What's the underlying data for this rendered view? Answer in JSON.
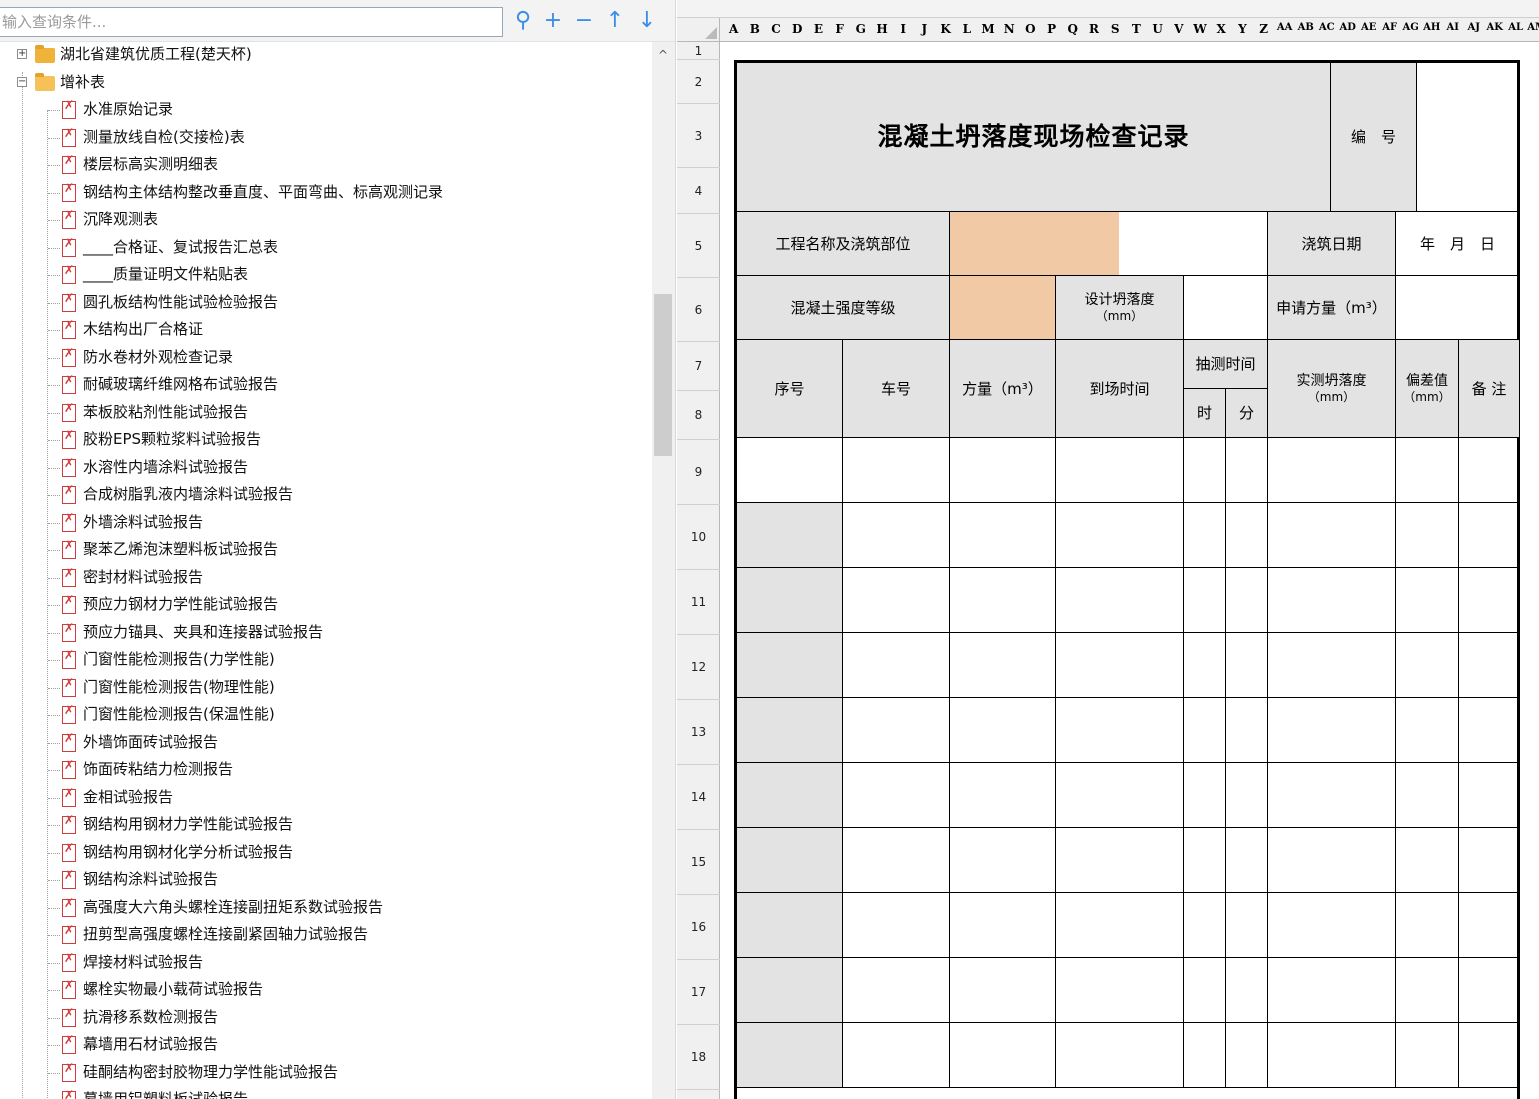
{
  "search": {
    "placeholder": "输入查询条件..."
  },
  "tree": {
    "nodes": [
      {
        "label": "湖北省建筑优质工程(楚天杯)",
        "type": "folder",
        "expanded": false
      },
      {
        "label": "增补表",
        "type": "folder",
        "expanded": true
      },
      {
        "label": "水准原始记录"
      },
      {
        "label": "测量放线自检(交接检)表"
      },
      {
        "label": "楼层标高实测明细表"
      },
      {
        "label": "钢结构主体结构整改垂直度、平面弯曲、标高观测记录"
      },
      {
        "label": "沉降观测表"
      },
      {
        "label": "____合格证、复试报告汇总表"
      },
      {
        "label": "____质量证明文件粘贴表"
      },
      {
        "label": "圆孔板结构性能试验检验报告"
      },
      {
        "label": "木结构出厂合格证"
      },
      {
        "label": "防水卷材外观检查记录"
      },
      {
        "label": "耐碱玻璃纤维网格布试验报告"
      },
      {
        "label": "苯板胶粘剂性能试验报告"
      },
      {
        "label": "胶粉EPS颗粒浆料试验报告"
      },
      {
        "label": "水溶性内墙涂料试验报告"
      },
      {
        "label": "合成树脂乳液内墙涂料试验报告"
      },
      {
        "label": "外墙涂料试验报告"
      },
      {
        "label": "聚苯乙烯泡沫塑料板试验报告"
      },
      {
        "label": "密封材料试验报告"
      },
      {
        "label": "预应力钢材力学性能试验报告"
      },
      {
        "label": "预应力锚具、夹具和连接器试验报告"
      },
      {
        "label": "门窗性能检测报告(力学性能)"
      },
      {
        "label": "门窗性能检测报告(物理性能)"
      },
      {
        "label": "门窗性能检测报告(保温性能)"
      },
      {
        "label": "外墙饰面砖试验报告"
      },
      {
        "label": "饰面砖粘结力检测报告"
      },
      {
        "label": "金相试验报告"
      },
      {
        "label": "钢结构用钢材力学性能试验报告"
      },
      {
        "label": "钢结构用钢材化学分析试验报告"
      },
      {
        "label": "钢结构涂料试验报告"
      },
      {
        "label": "高强度大六角头螺栓连接副扭矩系数试验报告"
      },
      {
        "label": "扭剪型高强度螺栓连接副紧固轴力试验报告"
      },
      {
        "label": "焊接材料试验报告"
      },
      {
        "label": "螺栓实物最小载荷试验报告"
      },
      {
        "label": "抗滑移系数检测报告"
      },
      {
        "label": "幕墙用石材试验报告"
      },
      {
        "label": "硅酮结构密封胶物理力学性能试验报告"
      },
      {
        "label": "幕墙用铝塑料板试验报告"
      }
    ]
  },
  "sheet": {
    "columns": [
      "A",
      "B",
      "C",
      "D",
      "E",
      "F",
      "G",
      "H",
      "I",
      "J",
      "K",
      "L",
      "M",
      "N",
      "O",
      "P",
      "Q",
      "R",
      "S",
      "T",
      "U",
      "V",
      "W",
      "X",
      "Y",
      "Z",
      "AA",
      "AB",
      "AC",
      "AD",
      "AE",
      "AF",
      "AG",
      "AH",
      "AI",
      "AJ",
      "AK",
      "AL",
      "AM"
    ],
    "rows": [
      "1",
      "2",
      "3",
      "4",
      "5",
      "6",
      "7",
      "8",
      "9",
      "10",
      "11",
      "12",
      "13",
      "14",
      "15",
      "16",
      "17",
      "18"
    ],
    "form": {
      "title": "混凝土坍落度现场检查记录",
      "number_label": "编　号",
      "project_label": "工程名称及浇筑部位",
      "pour_date_label": "浇筑日期",
      "date_placeholder": "年　月　日",
      "grade_label": "混凝土强度等级",
      "design_slump_label": "设计坍落度",
      "mm_unit": "（mm）",
      "volume_request_label": "申请方量（m³）",
      "col_seq": "序号",
      "col_car": "车号",
      "col_volume": "方量（m³）",
      "col_arrival": "到场时间",
      "col_sample_time": "抽测时间",
      "col_hour": "时",
      "col_minute": "分",
      "col_measured_slump": "实测坍落度",
      "col_deviation": "偏差值",
      "col_remark": "备 注"
    }
  },
  "colors": {
    "accent": "#3a8ee6",
    "header_gray": "#e3e3e3",
    "input_orange": "#f1c9a5"
  }
}
